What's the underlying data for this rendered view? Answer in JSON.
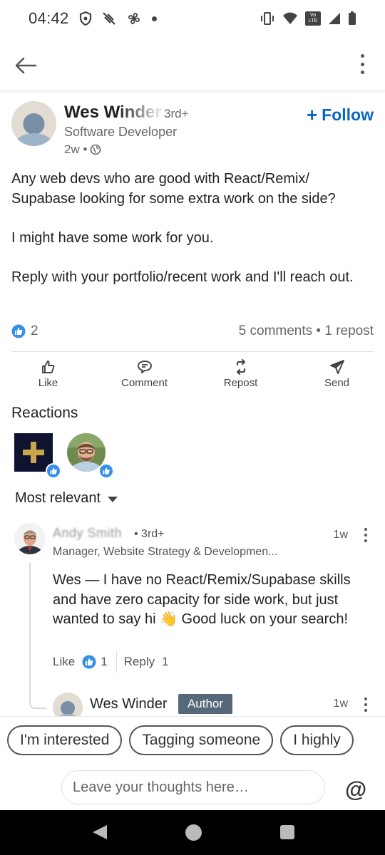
{
  "status_bar": {
    "time": "04:42",
    "icons": [
      "shield-icon",
      "no-notifications-icon",
      "fan-icon",
      "dot-icon",
      "vibrate-icon",
      "wifi-icon",
      "volte-icon",
      "signal-icon",
      "battery-icon"
    ],
    "volte_label": "Vo LTE"
  },
  "app_bar": {
    "icons": [
      "back-arrow-icon",
      "more-vertical-icon"
    ]
  },
  "post": {
    "author_name": "Wes Winder",
    "degree": "3rd+",
    "headline": "Software Developer",
    "time": "2w •",
    "visibility_icon": "globe-icon",
    "follow_label": "Follow",
    "body": [
      "Any web devs who are good with React/Remix/ Supabase looking for some extra work on the side?",
      "I might have some work for you.",
      "Reply with your portfolio/recent work and I'll reach out."
    ],
    "reaction_count": "2",
    "comments_reposts": "5 comments • 1 repost"
  },
  "actions": [
    {
      "label": "Like",
      "icon": "like-icon"
    },
    {
      "label": "Comment",
      "icon": "comment-icon"
    },
    {
      "label": "Repost",
      "icon": "repost-icon"
    },
    {
      "label": "Send",
      "icon": "send-icon"
    }
  ],
  "reactions": {
    "title": "Reactions"
  },
  "sort": {
    "label": "Most relevant"
  },
  "comment": {
    "name": "Andy Smith",
    "degree": "• 3rd+",
    "headline": "Manager, Website Strategy & Developmen...",
    "time": "1w",
    "text": "Wes — I have no React/Remix/Supabase skills and have zero capacity for side work, but just wanted to say hi 👋 Good luck on your search!",
    "like_label": "Like",
    "like_count": "1",
    "reply_label": "Reply",
    "reply_count": "1"
  },
  "reply": {
    "name": "Wes Winder",
    "badge": "Author",
    "time": "1w"
  },
  "suggestions": [
    "I'm interested",
    "Tagging someone",
    "I highly"
  ],
  "compose": {
    "placeholder": "Leave your thoughts here…",
    "mention_symbol": "@"
  },
  "colors": {
    "brand_blue": "#0a66c2",
    "like_blue": "#378fe9",
    "author_badge": "#56687a"
  }
}
